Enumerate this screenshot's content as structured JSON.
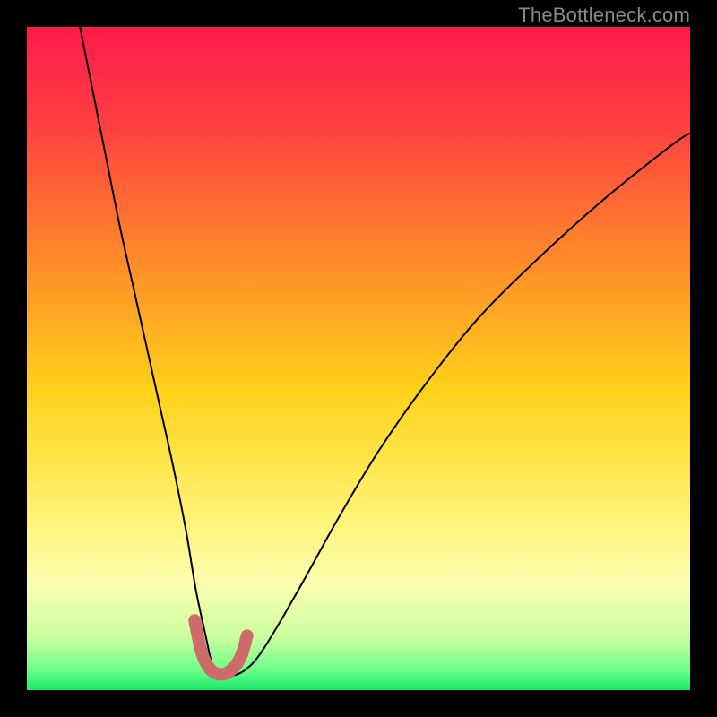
{
  "watermark": "TheBottleneck.com",
  "chart_data": {
    "type": "line",
    "title": "",
    "xlabel": "",
    "ylabel": "",
    "xlim": [
      0,
      100
    ],
    "ylim": [
      0,
      100
    ],
    "background_gradient": {
      "stops": [
        {
          "offset": 0.0,
          "color": "#ff1a4b"
        },
        {
          "offset": 0.15,
          "color": "#ff4040"
        },
        {
          "offset": 0.35,
          "color": "#ff8a2a"
        },
        {
          "offset": 0.55,
          "color": "#ffd21a"
        },
        {
          "offset": 0.72,
          "color": "#fff06a"
        },
        {
          "offset": 0.84,
          "color": "#fcffb0"
        },
        {
          "offset": 0.92,
          "color": "#caff9e"
        },
        {
          "offset": 0.97,
          "color": "#6dff89"
        },
        {
          "offset": 1.0,
          "color": "#18e86b"
        }
      ]
    },
    "series": [
      {
        "name": "bottleneck-curve",
        "stroke": "#000000",
        "stroke_width": 2,
        "x": [
          8,
          10,
          12,
          14,
          16,
          18,
          20,
          22,
          24,
          25.5,
          27,
          28,
          28.8,
          30,
          31.5,
          33,
          35,
          38,
          42,
          47,
          53,
          60,
          68,
          77,
          87,
          97,
          100
        ],
        "y": [
          100,
          90,
          80,
          70,
          61,
          52,
          43,
          34,
          24,
          15,
          8,
          3.5,
          2.3,
          2.1,
          2.3,
          3.1,
          5.2,
          10,
          17,
          26,
          36,
          46,
          56,
          65,
          74,
          82,
          84
        ]
      },
      {
        "name": "highlight-bottom",
        "stroke": "#cf6a6a",
        "stroke_width": 14,
        "linecap": "round",
        "x": [
          25.3,
          26.4,
          27.6,
          28.9,
          30.2,
          31.4,
          32.4,
          33.2
        ],
        "y": [
          10.5,
          5.5,
          3.2,
          2.4,
          2.6,
          3.6,
          5.4,
          8.2
        ]
      }
    ]
  }
}
